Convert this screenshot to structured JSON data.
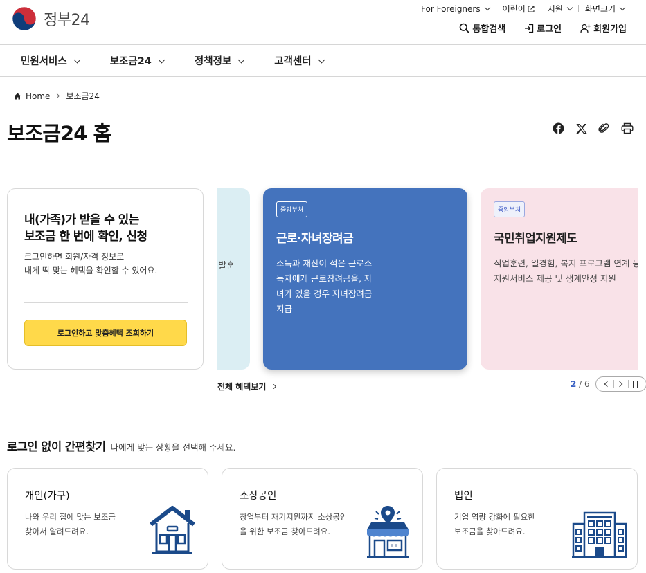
{
  "header": {
    "logo_text": "정부24",
    "utility": [
      {
        "label": "For Foreigners",
        "icon": "chevron-down-icon"
      },
      {
        "label": "어린이",
        "icon": "external-link-icon"
      },
      {
        "label": "지원",
        "icon": "chevron-down-icon"
      },
      {
        "label": "화면크기",
        "icon": "chevron-down-icon"
      }
    ],
    "actions": [
      {
        "label": "통합검색",
        "icon": "search-icon"
      },
      {
        "label": "로그인",
        "icon": "login-icon"
      },
      {
        "label": "회원가입",
        "icon": "user-add-icon"
      }
    ]
  },
  "nav": {
    "items": [
      {
        "label": "민원서비스"
      },
      {
        "label": "보조금24"
      },
      {
        "label": "정책정보"
      },
      {
        "label": "고객센터"
      }
    ]
  },
  "breadcrumb": {
    "home": "Home",
    "current": "보조금24"
  },
  "page_title": "보조금24 홈",
  "share_icons": [
    "facebook-icon",
    "x-icon",
    "link-icon",
    "print-icon"
  ],
  "login_card": {
    "title_line1": "내(가족)가 받을 수 있는",
    "title_line2": "보조금 한 번에 확인, 신청",
    "desc_line1": "로그인하면 회원/자격 정보로",
    "desc_line2": "내게 딱 맞는 혜택을 확인할 수 있어요.",
    "button": "로그인하고 맞춤혜택 조회하기"
  },
  "carousel": {
    "prev_slide_text": "발훈",
    "active": {
      "badge": "중앙부처",
      "title": "근로·자녀장려금",
      "desc_lines": [
        "소득과 재산이 적은 근로소",
        "득자에게 근로장려금을, 자",
        "녀가 있을 경우 자녀장려금",
        "지급"
      ]
    },
    "next": {
      "badge": "중앙부처",
      "title": "국민취업지원제도",
      "desc_lines": [
        "직업훈련, 일경험, 복지 프로그램 연계 등",
        "지원서비스 제공 및 생계안정 지원"
      ]
    },
    "all_benefits": "전체 혜택보기",
    "pager_current": "2",
    "pager_total": "6",
    "colors": {
      "active_bg": "#4473bd",
      "next_bg": "#f9e2e8",
      "prev_bg": "#dbeef3"
    }
  },
  "quick_find": {
    "title": "로그인 없이 간편찾기",
    "subtitle": "나에게 맞는 상황을 선택해 주세요.",
    "cards": [
      {
        "title": "개인(가구)",
        "desc_line1": "나와 우리 집에 맞는 보조금",
        "desc_line2": "찾아서 알려드려요.",
        "icon": "house-icon"
      },
      {
        "title": "소상공인",
        "desc_line1": "창업부터 재기지원까지 소상공인",
        "desc_line2": "을 위한 보조금 찾아드려요.",
        "icon": "store-icon"
      },
      {
        "title": "법인",
        "desc_line1": "기업 역량 강화에 필요한",
        "desc_line2": "보조금을 찾아드려요.",
        "icon": "building-icon"
      }
    ]
  },
  "accent_colors": {
    "brand_red": "#cd2e3a",
    "brand_blue": "#0f3d7a",
    "icon_navy": "#1b4a8a",
    "button_yellow": "#ffd94a"
  }
}
